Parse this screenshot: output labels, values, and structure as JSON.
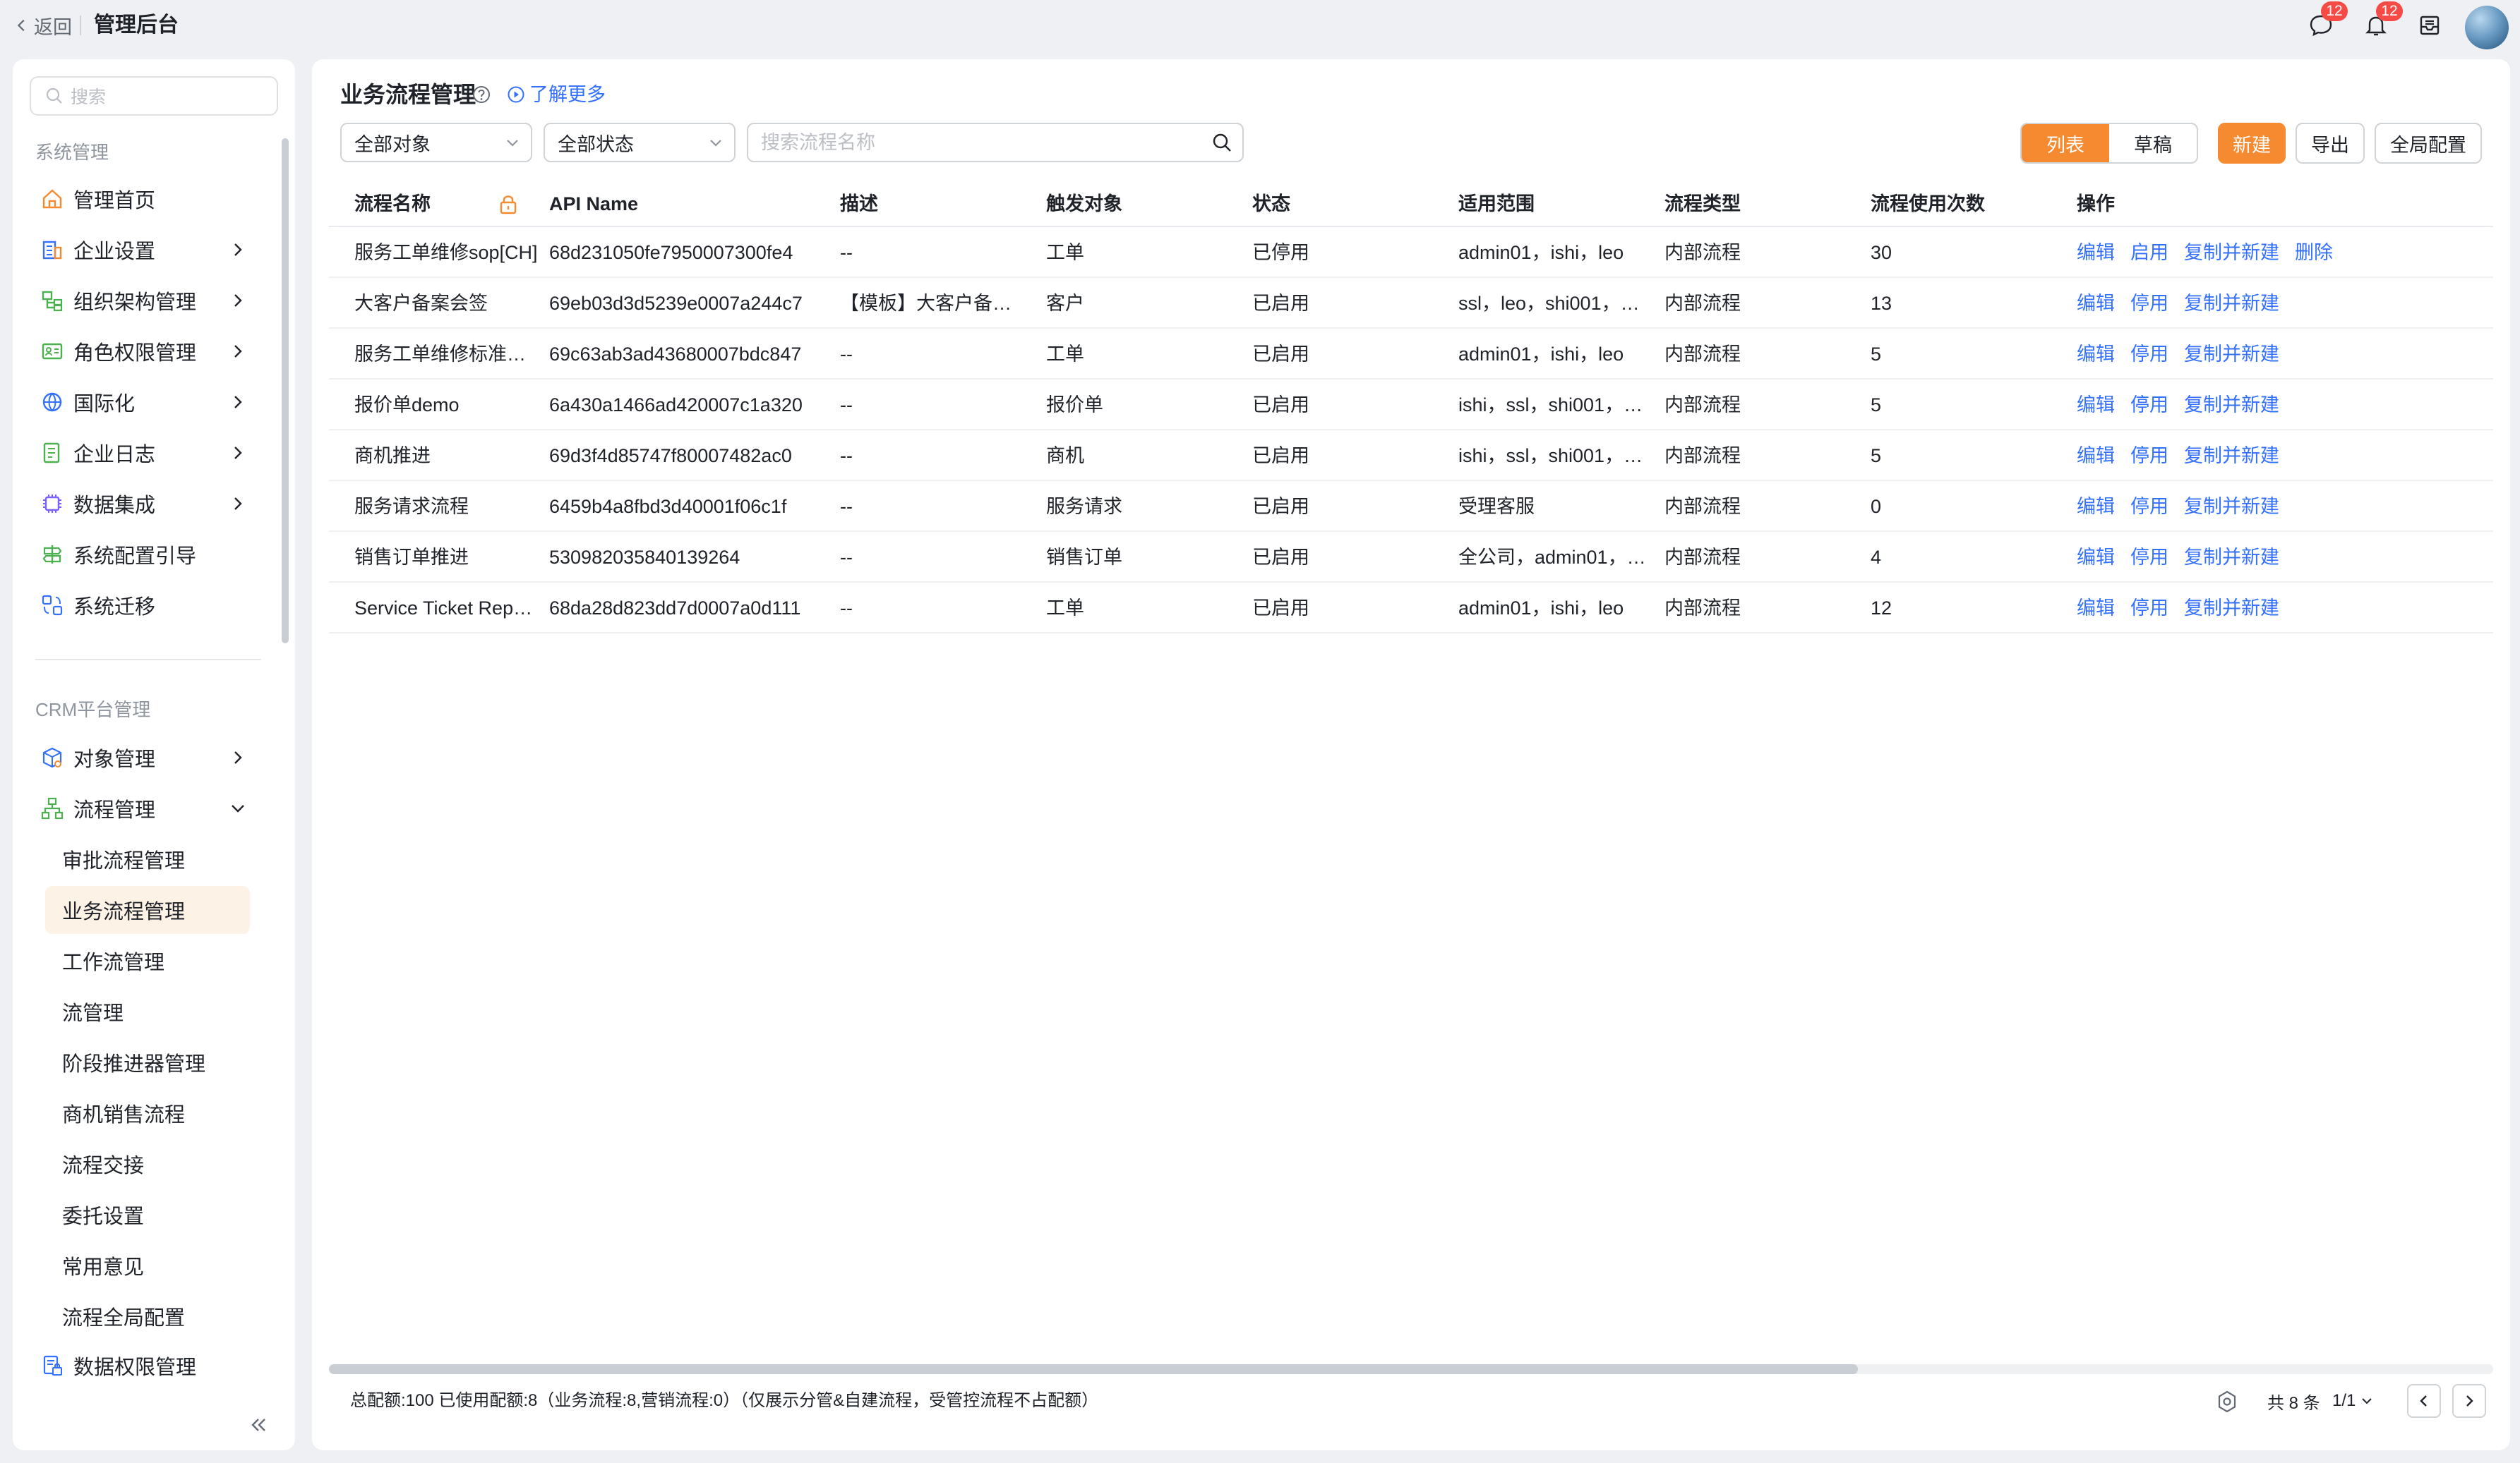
{
  "topbar": {
    "back_label": "返回",
    "title": "管理后台",
    "chat_badge": "12",
    "bell_badge": "12"
  },
  "sidebar": {
    "search_placeholder": "搜索",
    "section_system": "系统管理",
    "section_crm": "CRM平台管理",
    "system_items": [
      {
        "label": "管理首页",
        "icon": "home-icon"
      },
      {
        "label": "企业设置",
        "icon": "building-icon"
      },
      {
        "label": "组织架构管理",
        "icon": "org-chart-icon"
      },
      {
        "label": "角色权限管理",
        "icon": "role-card-icon"
      },
      {
        "label": "国际化",
        "icon": "globe-icon"
      },
      {
        "label": "企业日志",
        "icon": "log-icon"
      },
      {
        "label": "数据集成",
        "icon": "chip-icon"
      },
      {
        "label": "系统配置引导",
        "icon": "signpost-icon"
      },
      {
        "label": "系统迁移",
        "icon": "migrate-icon"
      }
    ],
    "crm_items": [
      {
        "label": "对象管理",
        "icon": "cube-icon"
      },
      {
        "label": "流程管理",
        "icon": "flow-icon"
      }
    ],
    "flow_sub_items": [
      "审批流程管理",
      "业务流程管理",
      "工作流管理",
      "流管理",
      "阶段推进器管理",
      "商机销售流程",
      "流程交接",
      "委托设置",
      "常用意见",
      "流程全局配置"
    ],
    "data_perm_label": "数据权限管理"
  },
  "main": {
    "title": "业务流程管理",
    "learn_more": "了解更多",
    "filter_object": "全部对象",
    "filter_status": "全部状态",
    "search_placeholder": "搜索流程名称",
    "view_list": "列表",
    "view_draft": "草稿",
    "btn_new": "新建",
    "btn_export": "导出",
    "btn_global": "全局配置"
  },
  "table": {
    "columns": [
      "流程名称",
      "API Name",
      "描述",
      "触发对象",
      "状态",
      "适用范围",
      "流程类型",
      "流程使用次数",
      "操作"
    ],
    "rows": [
      {
        "name": "服务工单维修sop[CH]",
        "api": "68d231050fe7950007300fe4",
        "desc": "--",
        "trigger": "工单",
        "status": "已停用",
        "scope": "admin01，ishi，leo",
        "type": "内部流程",
        "count": "30",
        "actions": [
          "编辑",
          "启用",
          "复制并新建",
          "删除"
        ]
      },
      {
        "name": "大客户备案会签",
        "api": "69eb03d3d5239e0007a244c7",
        "desc": "【模板】大客户备…",
        "trigger": "客户",
        "status": "已启用",
        "scope": "ssl，leo，shi001，…",
        "type": "内部流程",
        "count": "13",
        "actions": [
          "编辑",
          "停用",
          "复制并新建"
        ]
      },
      {
        "name": "服务工单维修标准作业",
        "api": "69c63ab3ad43680007bdc847",
        "desc": "--",
        "trigger": "工单",
        "status": "已启用",
        "scope": "admin01，ishi，leo",
        "type": "内部流程",
        "count": "5",
        "actions": [
          "编辑",
          "停用",
          "复制并新建"
        ]
      },
      {
        "name": "报价单demo",
        "api": "6a430a1466ad420007c1a320",
        "desc": "--",
        "trigger": "报价单",
        "status": "已启用",
        "scope": "ishi，ssl，shi001，…",
        "type": "内部流程",
        "count": "5",
        "actions": [
          "编辑",
          "停用",
          "复制并新建"
        ]
      },
      {
        "name": "商机推进",
        "api": "69d3f4d85747f80007482ac0",
        "desc": "--",
        "trigger": "商机",
        "status": "已启用",
        "scope": "ishi，ssl，shi001，…",
        "type": "内部流程",
        "count": "5",
        "actions": [
          "编辑",
          "停用",
          "复制并新建"
        ]
      },
      {
        "name": "服务请求流程",
        "api": "6459b4a8fbd3d40001f06c1f",
        "desc": "--",
        "trigger": "服务请求",
        "status": "已启用",
        "scope": "受理客服",
        "type": "内部流程",
        "count": "0",
        "actions": [
          "编辑",
          "停用",
          "复制并新建"
        ]
      },
      {
        "name": "销售订单推进",
        "api": "530982035840139264",
        "desc": "--",
        "trigger": "销售订单",
        "status": "已启用",
        "scope": "全公司，admin01，…",
        "type": "内部流程",
        "count": "4",
        "actions": [
          "编辑",
          "停用",
          "复制并新建"
        ]
      },
      {
        "name": "Service Ticket Repair :",
        "api": "68da28d823dd7d0007a0d111",
        "desc": "--",
        "trigger": "工单",
        "status": "已启用",
        "scope": "admin01，ishi，leo",
        "type": "内部流程",
        "count": "12",
        "actions": [
          "编辑",
          "停用",
          "复制并新建"
        ]
      }
    ]
  },
  "footer": {
    "quota_note": "总配额:100 已使用配额:8（业务流程:8,营销流程:0）（仅展示分管&自建流程，受管控流程不占配额）",
    "total": "共 8 条",
    "page": "1/1"
  },
  "colors": {
    "accent": "#f58a30",
    "link": "#3370ff",
    "badge": "#f54a45"
  }
}
